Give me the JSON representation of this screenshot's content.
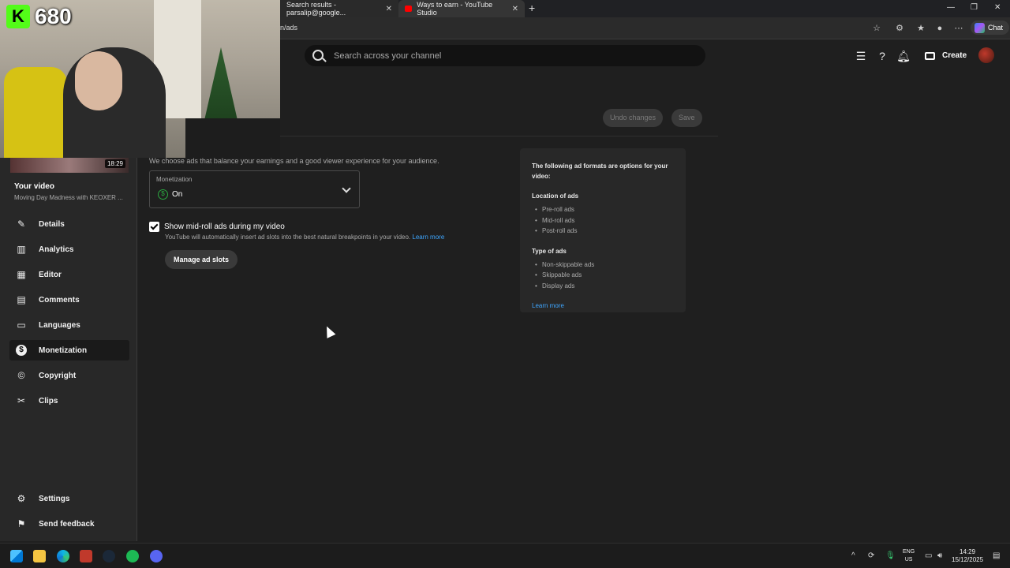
{
  "browser": {
    "tabs": [
      {
        "label": "Search results - parsalip@google..."
      },
      {
        "label": "Ways to earn - YouTube Studio"
      }
    ],
    "url": "n/ads",
    "chat_label": "Chat"
  },
  "header": {
    "search_placeholder": "Search across your channel",
    "create_label": "Create"
  },
  "overlay": {
    "kick_logo": "K",
    "viewer_count": "680"
  },
  "sidebar": {
    "thumb_duration": "18:29",
    "section_title": "Your video",
    "video_title": "Moving Day Madness with KEOXER ...",
    "items": [
      {
        "label": "Details",
        "icon": "✎"
      },
      {
        "label": "Analytics",
        "icon": "▥"
      },
      {
        "label": "Editor",
        "icon": "▦"
      },
      {
        "label": "Comments",
        "icon": "▤"
      },
      {
        "label": "Languages",
        "icon": "▭"
      },
      {
        "label": "Monetization",
        "icon": "$"
      },
      {
        "label": "Copyright",
        "icon": "©"
      },
      {
        "label": "Clips",
        "icon": "✂"
      }
    ],
    "settings_label": "Settings",
    "feedback_label": "Send feedback"
  },
  "toolbar": {
    "undo_label": "Undo changes",
    "save_label": "Save"
  },
  "main": {
    "intro": "We choose ads that balance your earnings and a good viewer experience for your audience.",
    "monetization_label": "Monetization",
    "monetization_value": "On",
    "midroll_label": "Show mid-roll ads during my video",
    "midroll_desc": "YouTube will automatically insert ad slots into the best natural breakpoints in your video.",
    "learn_more": "Learn more",
    "manage_slots": "Manage ad slots"
  },
  "info_card": {
    "heading": "The following ad formats are options for your video:",
    "location_title": "Location of ads",
    "locations": [
      "Pre-roll ads",
      "Mid-roll ads",
      "Post-roll ads"
    ],
    "type_title": "Type of ads",
    "types": [
      "Non-skippable ads",
      "Skippable ads",
      "Display ads"
    ],
    "learn_more": "Learn more"
  },
  "taskbar": {
    "lang_line1": "ENG",
    "lang_line2": "US",
    "time": "14:29",
    "date": "15/12/2025"
  }
}
